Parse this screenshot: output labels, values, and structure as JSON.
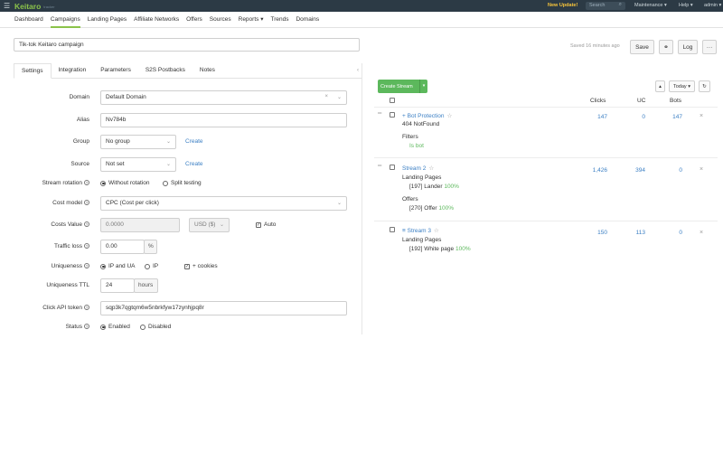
{
  "topbar": {
    "brand": "Keitaro",
    "brand_sub": "tracker",
    "new_update": "New Update!",
    "search_placeholder": "Search",
    "maintenance": "Maintenance",
    "help": "Help",
    "user": "admin"
  },
  "nav": {
    "items": [
      "Dashboard",
      "Campaigns",
      "Landing Pages",
      "Affiliate Networks",
      "Offers",
      "Sources",
      "Reports",
      "Trends",
      "Domains"
    ],
    "active": "Campaigns"
  },
  "campaign": {
    "name": "Tik-tok Keitaro campaign",
    "saved_status": "Saved 16 minutes ago",
    "save_label": "Save",
    "log_label": "Log"
  },
  "tabs": [
    "Settings",
    "Integration",
    "Parameters",
    "S2S Postbacks",
    "Notes"
  ],
  "settings": {
    "domain": {
      "label": "Domain",
      "value": "Default Domain"
    },
    "alias": {
      "label": "Alias",
      "value": "Nv784b"
    },
    "group": {
      "label": "Group",
      "value": "No group",
      "create": "Create"
    },
    "source": {
      "label": "Source",
      "value": "Not set",
      "create": "Create"
    },
    "rotation": {
      "label": "Stream rotation",
      "options": [
        "Without rotation",
        "Split testing"
      ],
      "selected": "Without rotation"
    },
    "cost_model": {
      "label": "Cost model",
      "value": "CPC (Cost per click)"
    },
    "costs_value": {
      "label": "Costs Value",
      "value": "0.0000",
      "currency": "USD ($)",
      "auto": "Auto"
    },
    "traffic_loss": {
      "label": "Traffic loss",
      "value": "0.00",
      "unit": "%"
    },
    "uniqueness": {
      "label": "Uniqueness",
      "options": [
        "IP and UA",
        "IP"
      ],
      "selected": "IP and UA",
      "cookies": "+ cookies"
    },
    "uniqueness_ttl": {
      "label": "Uniqueness TTL",
      "value": "24",
      "unit": "hours"
    },
    "click_api_token": {
      "label": "Click API token",
      "value": "sqp3k7qgtqm6w5nbrkfyw17zynhjpq8r"
    },
    "status": {
      "label": "Status",
      "options": [
        "Enabled",
        "Disabled"
      ],
      "selected": "Enabled"
    }
  },
  "streams_panel": {
    "create_label": "Create Stream",
    "period": "Today",
    "headers": {
      "clicks": "Clicks",
      "uc": "UC",
      "bots": "Bots"
    },
    "streams": [
      {
        "title": "Bot Protection",
        "lines": [
          "404 NotFound"
        ],
        "filters_label": "Filters",
        "filters_value": "Is bot",
        "clicks": "147",
        "uc": "0",
        "bots": "147"
      },
      {
        "title": "Stream 2",
        "landing_label": "Landing Pages",
        "landing": "[197] Lander",
        "landing_pct": "100%",
        "offers_label": "Offers",
        "offer": "[270] Offer",
        "offer_pct": "100%",
        "clicks": "1,426",
        "uc": "394",
        "bots": "0"
      },
      {
        "title": "Stream 3",
        "landing_label": "Landing Pages",
        "landing": "[192] White page",
        "landing_pct": "100%",
        "clicks": "150",
        "uc": "113",
        "bots": "0"
      }
    ]
  }
}
